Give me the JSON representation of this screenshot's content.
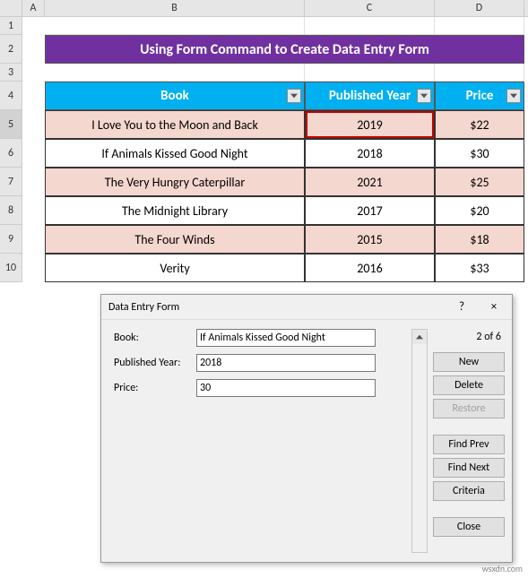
{
  "columns": [
    "A",
    "B",
    "C",
    "D"
  ],
  "rows": [
    "1",
    "2",
    "3",
    "4",
    "5",
    "6",
    "7",
    "8",
    "9",
    "10"
  ],
  "title": "Using Form Command to Create Data Entry Form",
  "headers": {
    "book": "Book",
    "year": "Published Year",
    "price": "Price"
  },
  "table": [
    {
      "book": "I Love You to the Moon and Back",
      "year": "2019",
      "price": "$22"
    },
    {
      "book": "If Animals Kissed Good Night",
      "year": "2018",
      "price": "$30"
    },
    {
      "book": "The Very Hungry Caterpillar",
      "year": "2021",
      "price": "$25"
    },
    {
      "book": "The Midnight Library",
      "year": "2017",
      "price": "$20"
    },
    {
      "book": "The Four Winds",
      "year": "2015",
      "price": "$18"
    },
    {
      "book": "Verity",
      "year": "2016",
      "price": "$33"
    }
  ],
  "dialog": {
    "title": "Data Entry Form",
    "help": "?",
    "close": "×",
    "labels": {
      "book": "Book:",
      "year": "Published Year:",
      "price": "Price:"
    },
    "values": {
      "book": "If Animals Kissed Good Night",
      "year": "2018",
      "price": "30"
    },
    "counter": "2 of 6",
    "buttons": {
      "new": "New",
      "delete": "Delete",
      "restore": "Restore",
      "findprev": "Find Prev",
      "findnext": "Find Next",
      "criteria": "Criteria",
      "close": "Close"
    }
  },
  "watermark": "wsxdn.com"
}
